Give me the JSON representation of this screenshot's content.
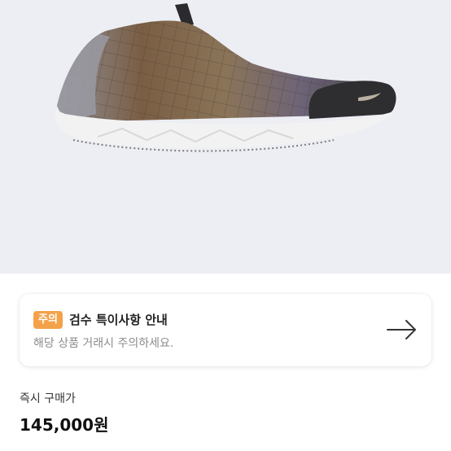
{
  "notice": {
    "badge": "주의",
    "title": "검수 특이사항 안내",
    "subtitle": "해당 상품 거래시 주의하세요.",
    "arrow_icon": "arrow-right-icon"
  },
  "purchase": {
    "label": "즉시 구매가",
    "price": "145,000원"
  },
  "colors": {
    "product_background": "#eceef4",
    "badge": "#f4a24a",
    "subtitle_text": "#8c8c8c"
  }
}
